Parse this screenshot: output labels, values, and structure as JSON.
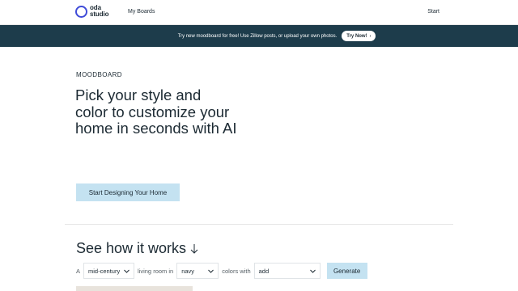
{
  "header": {
    "logo_line1": "oda",
    "logo_line2": "studio",
    "nav_boards": "My Boards",
    "nav_start": "Start"
  },
  "banner": {
    "text": "Try new moodboard for free! Use Zillow posts, or upload your own photos.",
    "button": "Try Now!"
  },
  "hero": {
    "eyebrow": "MOODBOARD",
    "title": "Pick your style and color to customize your home in seconds with AI",
    "cta": "Start Designing Your Home"
  },
  "how": {
    "title": "See how it works",
    "sentence": {
      "a": "A",
      "style_value": "mid-century",
      "living_room_in": "living room in",
      "color_value": "navy",
      "colors_with": "colors with",
      "extra_value": "add",
      "generate": "Generate"
    }
  },
  "colors": {
    "brand_ring": "#3f4bd8",
    "banner_bg": "#1d3c4b",
    "cta_bg": "#c4e2f1",
    "text": "#1c2a33"
  },
  "icons": {
    "logo": "circle-ring-icon",
    "banner_button": "arrow-right-icon",
    "how_title": "arrow-down-icon",
    "select": "chevron-down-icon"
  }
}
